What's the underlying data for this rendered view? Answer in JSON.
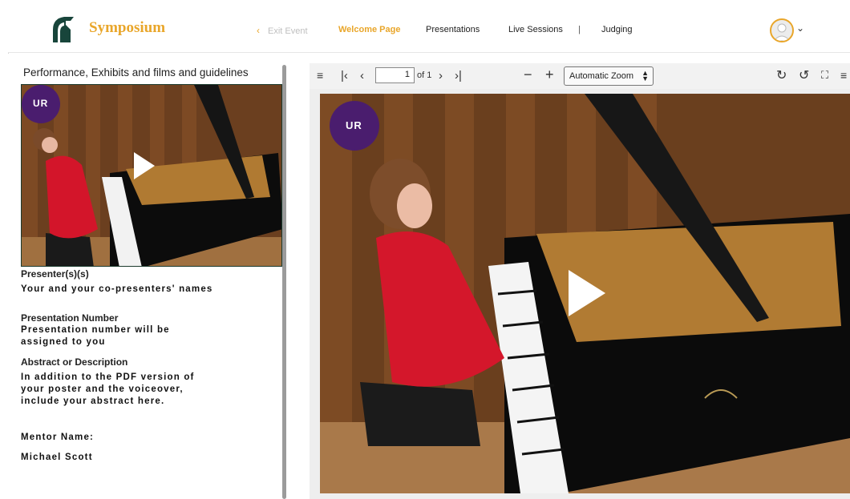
{
  "header": {
    "brand": "Symposium",
    "nav": {
      "exit": "Exit Event",
      "welcome": "Welcome Page",
      "presentations": "Presentations",
      "live_sessions": "Live Sessions",
      "separator": "|",
      "judging": "Judging"
    },
    "icons": {
      "logo": "spartan-helmet-logo",
      "back": "chevron-left-icon",
      "avatar": "user-avatar-icon",
      "menu": "chevron-down-icon"
    }
  },
  "left_panel": {
    "title": "Performance, Exhibits and films and guidelines",
    "badge": "UR",
    "presenter_label": "Presenter(s)(s)",
    "presenter_value": "Your and your co-presenters' names",
    "number_label": "Presentation Number",
    "number_value": "Presentation number will be assigned to you",
    "abstract_label": "Abstract or Description",
    "abstract_value": "In addition to the PDF version of your poster and the voiceover, include your abstract here.",
    "mentor_label": "Mentor Name:",
    "mentor_value": "Michael Scott"
  },
  "viewer": {
    "page_value": "1",
    "page_total": "of 1",
    "zoom": "Automatic Zoom",
    "badge": "UR",
    "icons": [
      "sidebar-toggle-icon",
      "first-page-icon",
      "previous-page-icon",
      "next-page-icon",
      "last-page-icon",
      "zoom-out-icon",
      "zoom-in-icon",
      "rotate-cw-icon",
      "rotate-ccw-icon",
      "fullscreen-icon",
      "tools-menu-icon"
    ]
  },
  "colors": {
    "accent": "#e9a62a",
    "brand_green": "#18453b",
    "badge_purple": "#4a1d6e"
  }
}
